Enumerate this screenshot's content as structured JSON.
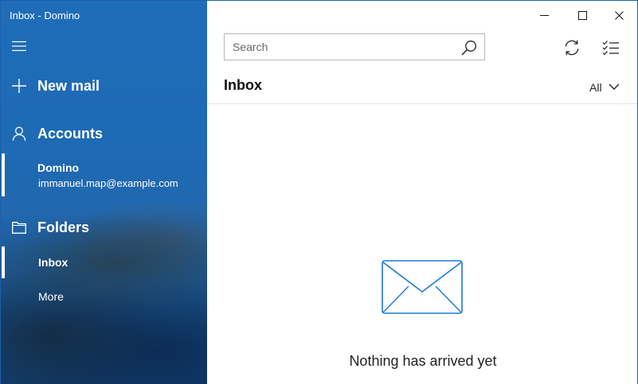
{
  "window": {
    "title": "Inbox - Domino"
  },
  "sidebar": {
    "new_mail_label": "New mail",
    "accounts_label": "Accounts",
    "account": {
      "name": "Domino",
      "email": "immanuel.map@example.com"
    },
    "folders_label": "Folders",
    "folders": [
      {
        "label": "Inbox",
        "selected": true
      },
      {
        "label": "More",
        "selected": false
      }
    ]
  },
  "main": {
    "search": {
      "placeholder": "Search",
      "value": ""
    },
    "list_title": "Inbox",
    "filter": {
      "selected": "All"
    },
    "empty_message": "Nothing has arrived yet"
  },
  "colors": {
    "accent": "#1d6ab5",
    "envelope_stroke": "#1a7ad4"
  },
  "icons": {
    "menu": "hamburger-icon",
    "compose": "plus-icon",
    "accounts": "person-icon",
    "folders": "folder-icon",
    "search": "search-icon",
    "sync": "sync-icon",
    "select": "checklist-icon",
    "filter": "chevron-down-icon",
    "empty": "envelope-icon"
  }
}
